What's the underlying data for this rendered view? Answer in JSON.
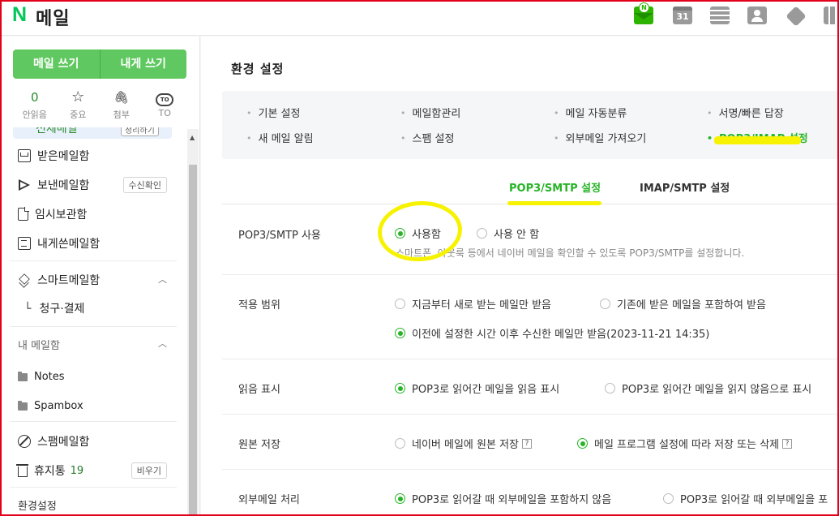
{
  "header": {
    "logo_letter": "N",
    "app_title": "메일",
    "calendar_day": "31"
  },
  "sidebar": {
    "write_mail": "메일 쓰기",
    "write_self": "내게 쓰기",
    "quick": [
      {
        "top": "0",
        "label": "안읽음"
      },
      {
        "top": "☆",
        "label": "중요"
      },
      {
        "top": "🖇",
        "label": "첨부"
      },
      {
        "top": "TO",
        "label": "TO"
      }
    ],
    "cut_label": "전체메일",
    "cut_button": "정리하기",
    "items": {
      "inbox": "받은메일함",
      "sent": "보낸메일함",
      "sent_btn": "수신확인",
      "drafts": "임시보관함",
      "self": "내게쓴메일함",
      "smart": "스마트메일함",
      "billing": "청구·결제",
      "my_mailbox": "내 메일함",
      "notes": "Notes",
      "spambox": "Spambox",
      "spam": "스팸메일함",
      "trash": "휴지통",
      "trash_count": "19",
      "trash_btn": "비우기",
      "settings": "환경설정"
    }
  },
  "main": {
    "title": "환경 설정",
    "menu": [
      "기본 설정",
      "메일함관리",
      "메일 자동분류",
      "서명/빠른 답장",
      "새 메일 알림",
      "스팸 설정",
      "외부메일 가져오기",
      "POP3/IMAP 설정"
    ],
    "tabs": [
      "POP3/SMTP 설정",
      "IMAP/SMTP 설정"
    ],
    "rows": {
      "use_label": "POP3/SMTP 사용",
      "use_on": "사용함",
      "use_off": "사용 안 함",
      "use_desc": "스마트폰, 아웃룩 등에서 네이버 메일을 확인할 수 있도록 POP3/SMTP를 설정합니다.",
      "scope_label": "적용 범위",
      "scope_1": "지금부터 새로 받는 메일만 받음",
      "scope_2": "기존에 받은 메일을 포함하여 받음",
      "scope_3": "이전에 설정한 시간 이후 수신한 메일만 받음(2023-11-21 14:35)",
      "read_label": "읽음 표시",
      "read_1": "POP3로 읽어간 메일을 읽음 표시",
      "read_2": "POP3로 읽어간 메일을 읽지 않음으로 표시",
      "orig_label": "원본 저장",
      "orig_1": "네이버 메일에 원본 저장",
      "orig_2": "메일 프로그램 설정에 따라 저장 또는 삭제",
      "ext_label": "외부메일 처리",
      "ext_1": "POP3로 읽어갈 때 외부메일을 포함하지 않음",
      "ext_2": "POP3로 읽어갈 때 외부메일을 포"
    }
  },
  "colors": {
    "accent": "#27b427",
    "brand": "#03c75a",
    "highlight": "#f7f200",
    "frame": "#e3001b"
  }
}
